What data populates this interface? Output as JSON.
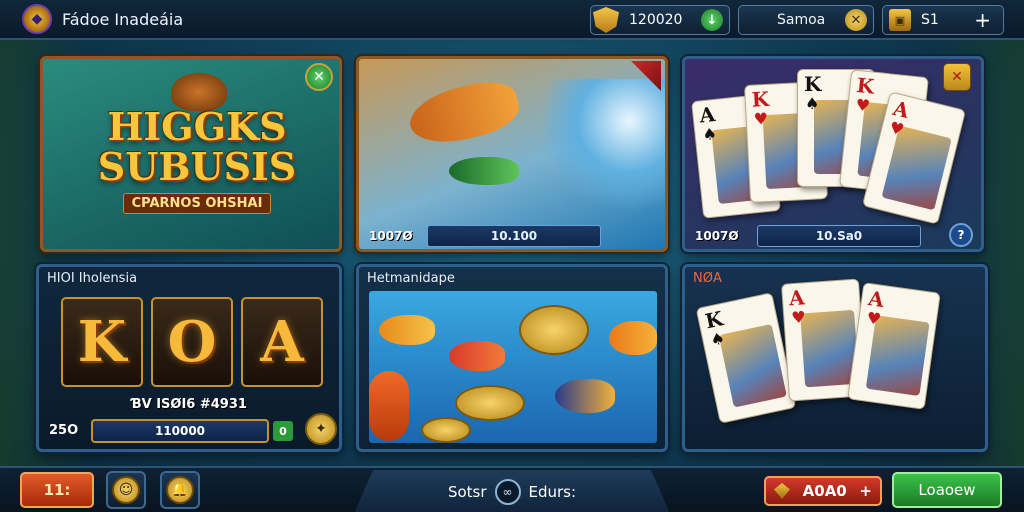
{
  "app": {
    "title": "Fádoe Inadeáia"
  },
  "header": {
    "coins": "120020",
    "mode_label": "Samoa",
    "gems": "S1",
    "add_symbol": "+"
  },
  "tiles": [
    {
      "title_line1": "HIGGKS",
      "title_line2": "SUBUSIS",
      "subtitle": "CPARNOS OHSHAI"
    },
    {
      "stat_left": "1007Ø",
      "stat_value": "10.100"
    },
    {
      "stat_left": "1007Ø",
      "stat_value": "10.Sa0"
    },
    {
      "label": "HIOI Iholensia",
      "letters": [
        "K",
        "O",
        "A"
      ],
      "bonus": "ƁV ISØI6 #4931",
      "left": "25O",
      "bar": "110000",
      "go": "0"
    },
    {
      "label": "Hetmanidape"
    },
    {
      "label": "NØA"
    }
  ],
  "cards": {
    "top": [
      {
        "rank": "A",
        "suit": "♠",
        "color": "black"
      },
      {
        "rank": "K",
        "suit": "♥",
        "color": "red"
      },
      {
        "rank": "K",
        "suit": "♠",
        "color": "black"
      },
      {
        "rank": "K",
        "suit": "♥",
        "color": "red"
      },
      {
        "rank": "A",
        "suit": "♥",
        "color": "red"
      }
    ],
    "bottom": [
      {
        "rank": "K",
        "suit": "♠",
        "color": "black"
      },
      {
        "rank": "A",
        "suit": "♥",
        "color": "red"
      },
      {
        "rank": "A",
        "suit": "♥",
        "color": "red"
      }
    ]
  },
  "footer": {
    "left_button": "11:",
    "center_left": "Sotsr",
    "center_right": "Edurs:",
    "bet_value": "A0A0",
    "bet_plus": "+",
    "play_button": "Loaoew"
  }
}
